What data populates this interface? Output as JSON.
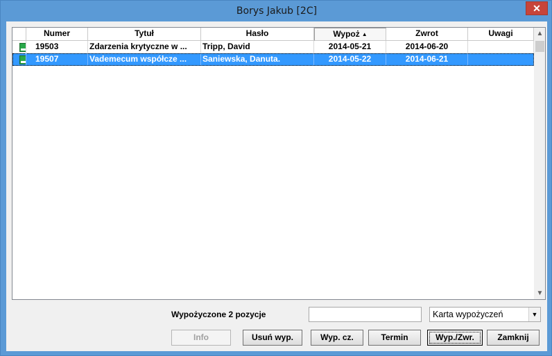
{
  "window": {
    "title": "Borys Jakub [2C]",
    "close_glyph": "✕"
  },
  "table": {
    "columns": [
      "Numer",
      "Tytuł",
      "Hasło",
      "Wypoż",
      "Zwrot",
      "Uwagi"
    ],
    "sorted_column": "Wypoż",
    "sort_direction": "ascending",
    "rows": [
      {
        "icon": "book-icon",
        "numer": "19503",
        "tytul": "Zdarzenia krytyczne w ...",
        "haslo": "Tripp, David",
        "wypoz": "2014-05-21",
        "zwrot": "2014-06-20",
        "uwagi": "",
        "selected": false
      },
      {
        "icon": "book-icon",
        "numer": "19507",
        "tytul": "Vademecum współcze ...",
        "haslo": "Saniewska, Danuta.",
        "wypoz": "2014-05-22",
        "zwrot": "2014-06-21",
        "uwagi": "",
        "selected": true
      }
    ]
  },
  "status": {
    "label": "Wypożyczone 2 pozycje"
  },
  "search": {
    "value": ""
  },
  "view_select": {
    "value": "Karta wypożyczeń"
  },
  "buttons": {
    "info": "Info",
    "usun": "Usuń wyp.",
    "wyp_cz": "Wyp. cz.",
    "termin": "Termin",
    "wyp_zwr": "Wyp./Zwr.",
    "zamknij": "Zamknij"
  },
  "colors": {
    "titlebar": "#5b9ad6",
    "close": "#c7443a",
    "selection": "#3399ff",
    "book_icon": "#2aa84a"
  }
}
